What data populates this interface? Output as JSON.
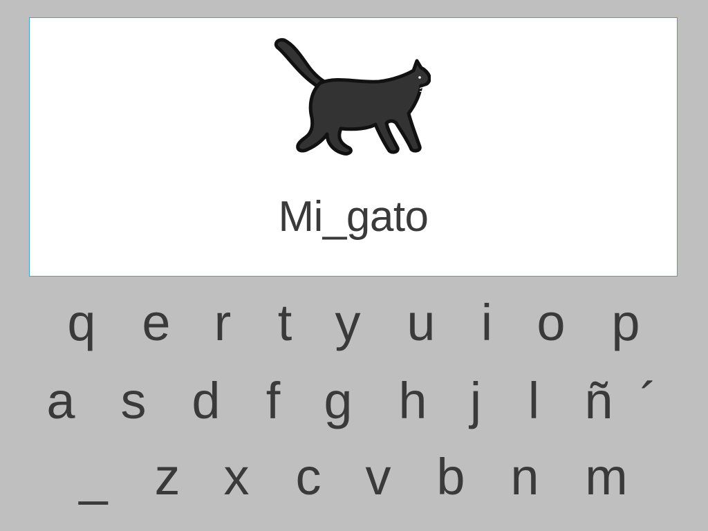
{
  "card": {
    "picture": "cat-walking-icon",
    "word": "Mi_gato"
  },
  "keyboard": {
    "row1": [
      "q",
      "e",
      "r",
      "t",
      "y",
      "u",
      "i",
      "o",
      "p"
    ],
    "row2": [
      "a",
      "s",
      "d",
      "f",
      "g",
      "h",
      "j",
      "l",
      "ñ",
      "´"
    ],
    "row3": [
      "_",
      "z",
      "x",
      "c",
      "v",
      "b",
      "n",
      "m"
    ]
  },
  "colors": {
    "background": "#bfbfbf",
    "card": "#ffffff",
    "card_border": "#3da3cf",
    "text": "#3a3a3a",
    "cat_fill": "#333333"
  }
}
